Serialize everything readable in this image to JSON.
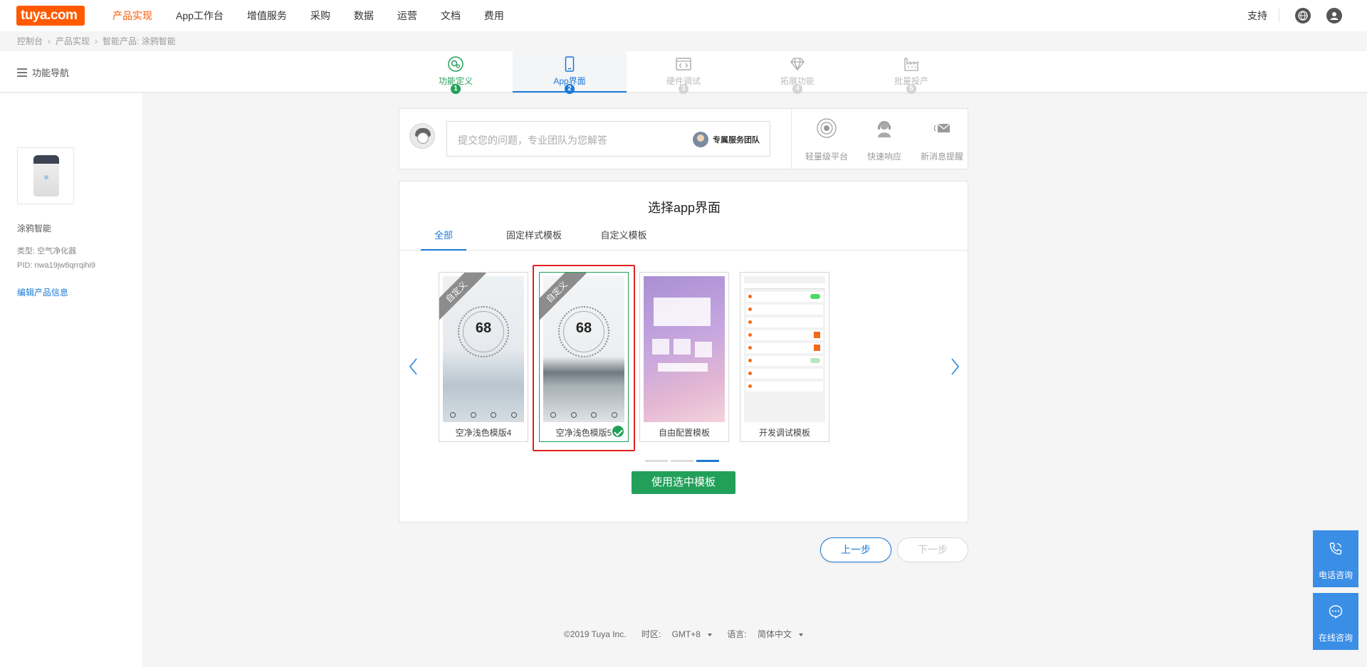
{
  "brand": {
    "logo": "tuya.com"
  },
  "topnav": {
    "items": [
      "产品实现",
      "App工作台",
      "增值服务",
      "采购",
      "数据",
      "运营",
      "文档",
      "费用"
    ],
    "active_index": 0,
    "support": "支持"
  },
  "breadcrumb": [
    "控制台",
    "产品实现",
    "智能产品: 涂鸦智能"
  ],
  "subnav": {
    "toggle_label": "功能导航"
  },
  "steps": [
    {
      "label": "功能定义",
      "num": "1",
      "state": "done"
    },
    {
      "label": "App界面",
      "num": "2",
      "state": "active"
    },
    {
      "label": "硬件调试",
      "num": "3",
      "state": "todo"
    },
    {
      "label": "拓展功能",
      "num": "4",
      "state": "todo"
    },
    {
      "label": "批量投产",
      "num": "5",
      "state": "todo"
    }
  ],
  "product": {
    "name": "涂鸦智能",
    "type": "类型: 空气净化器",
    "pid": "PID: nwa19jw8qrrqihi9",
    "edit": "编辑产品信息"
  },
  "ask": {
    "placeholder": "提交您的问题，专业团队为您解答",
    "team_button": "专属服务团队",
    "features": [
      "轻量级平台",
      "快速响应",
      "新消息提醒"
    ]
  },
  "main": {
    "title": "选择app界面",
    "tabs": [
      "全部",
      "固定样式模板",
      "自定义模板"
    ],
    "active_tab": 0,
    "templates": [
      {
        "name": "空净浅色模版4",
        "ribbon": "自定义",
        "value": "68"
      },
      {
        "name": "空净浅色模版5",
        "ribbon": "自定义",
        "value": "68",
        "selected": true
      },
      {
        "name": "自由配置模板"
      },
      {
        "name": "开发调试模板"
      }
    ],
    "carousel_active_page": 3,
    "use_button": "使用选中模板"
  },
  "buttons": {
    "prev": "上一步",
    "next": "下一步"
  },
  "footer": {
    "copyright": "©2019 Tuya Inc.",
    "timezone_label": "时区:",
    "timezone": "GMT+8",
    "language_label": "语言:",
    "language": "简体中文"
  },
  "float": {
    "phone": "电话咨询",
    "online": "在线咨询"
  },
  "colors": {
    "primary": "#1979d6",
    "success": "#22a05a",
    "brand": "#ff5a00",
    "highlight": "#e02020"
  }
}
